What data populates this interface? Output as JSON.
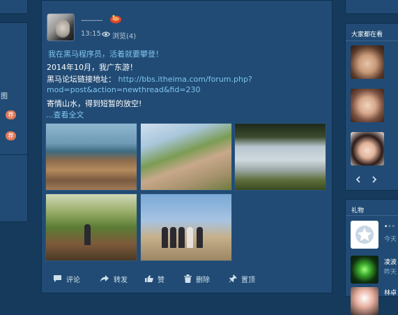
{
  "left_panel": {
    "items": [
      {
        "text": "图"
      },
      {
        "badge": "荐"
      },
      {
        "badge": "荐"
      }
    ]
  },
  "post": {
    "username": "··············",
    "time": "13:15",
    "views": "浏览(4)",
    "lines": [
      "我在黑马程序员，活着就要攀登！",
      "2014年10月，我广东游！",
      "黑马论坛链接地址：",
      "mod=post&action=newthread&fid=230",
      "寄情山水，得到短暂的放空!"
    ],
    "link_start": "http://bbs.itheima.com/forum.php?",
    "read_more": "...查看全文",
    "photos": [
      {
        "icon": "coastal-rocks-photo"
      },
      {
        "icon": "mountain-rock-flowers-photo"
      },
      {
        "icon": "city-view-photo"
      },
      {
        "icon": "wooden-bridge-forest-photo"
      },
      {
        "icon": "group-photo"
      }
    ],
    "actions": [
      {
        "label": "评论",
        "icon": "comment-icon"
      },
      {
        "label": "转发",
        "icon": "share-icon"
      },
      {
        "label": "赞",
        "icon": "thumbs-up-icon"
      },
      {
        "label": "删除",
        "icon": "trash-icon"
      },
      {
        "label": "置顶",
        "icon": "pin-icon"
      }
    ]
  },
  "right_panel": {
    "watch_title": "大家都在看",
    "gifts_title": "礼物",
    "gifts": [
      {
        "name": "•◦◦",
        "sub": "今天"
      },
      {
        "name": "凌波",
        "sub": "昨天"
      },
      {
        "name": "林卓",
        "sub": ""
      }
    ]
  },
  "colors": {
    "background": "#163a5c",
    "panel": "#214b74",
    "link": "#7ec4f0",
    "badge": "#e07a5b"
  }
}
